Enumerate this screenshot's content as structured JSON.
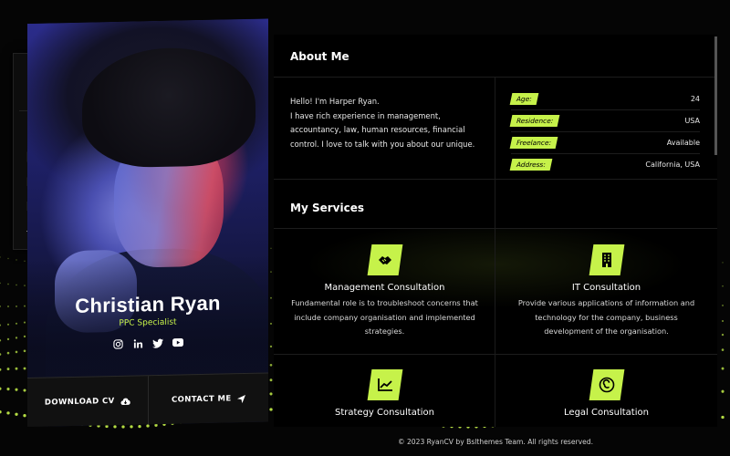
{
  "sidebar_tools": [
    {
      "icon": "menu-icon"
    },
    {
      "icon": "sun-icon"
    },
    {
      "icon": "user-icon"
    },
    {
      "icon": "resume-icon"
    },
    {
      "icon": "folder-icon"
    },
    {
      "icon": "news-icon"
    },
    {
      "icon": "send-icon"
    }
  ],
  "profile": {
    "name": "Christian Ryan",
    "role": "PPC Specialist",
    "socials": [
      "instagram-icon",
      "linkedin-icon",
      "twitter-icon",
      "youtube-icon"
    ],
    "download_cv": "DOWNLOAD CV",
    "contact_me": "CONTACT ME"
  },
  "about": {
    "title": "About Me",
    "greeting": "Hello! I'm Harper Ryan.",
    "text": "I have rich experience in management, accountancy, law, human resources, financial control. I love to talk with you about our unique.",
    "info": [
      {
        "key": "Age:",
        "value": "24"
      },
      {
        "key": "Residence:",
        "value": "USA"
      },
      {
        "key": "Freelance:",
        "value": "Available"
      },
      {
        "key": "Address:",
        "value": "California, USA"
      }
    ]
  },
  "services": {
    "title": "My Services",
    "items": [
      {
        "title": "Management Consultation",
        "desc": "Fundamental role is to troubleshoot concerns that include company organisation and implemented strategies.",
        "icon": "handshake-icon"
      },
      {
        "title": "IT Consultation",
        "desc": "Provide various applications of information and technology for the company, business development of the organisation.",
        "icon": "building-icon"
      },
      {
        "title": "Strategy Consultation",
        "desc": "",
        "icon": "chart-icon"
      },
      {
        "title": "Legal Consultation",
        "desc": "",
        "icon": "copyright-icon"
      }
    ]
  },
  "footer": "© 2023 RyanCV by Bslthemes Team. All rights reserved.",
  "colors": {
    "accent": "#c6f24a",
    "background": "#000000"
  }
}
